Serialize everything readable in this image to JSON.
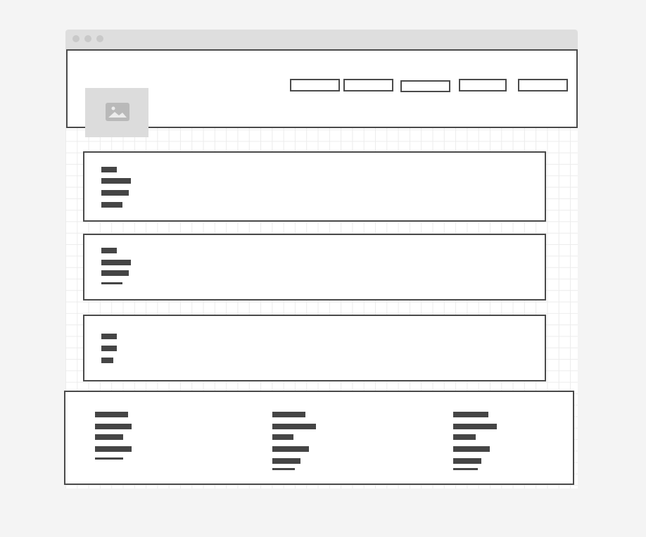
{
  "window": {
    "traffic_lights": [
      "close-dot",
      "minimize-dot",
      "maximize-dot"
    ]
  },
  "header": {
    "logo_icon": "image-placeholder-icon",
    "nav_buttons": [
      "",
      "",
      "",
      "",
      ""
    ]
  },
  "content_cards": [
    {
      "lines": [
        "",
        "",
        "",
        ""
      ]
    },
    {
      "lines": [
        "",
        "",
        "",
        ""
      ]
    },
    {
      "lines": [
        "",
        "",
        ""
      ]
    }
  ],
  "footer": {
    "columns": [
      {
        "lines": [
          "",
          "",
          "",
          "",
          ""
        ]
      },
      {
        "lines": [
          "",
          "",
          "",
          "",
          "",
          ""
        ]
      },
      {
        "lines": [
          "",
          "",
          "",
          "",
          "",
          ""
        ]
      }
    ]
  },
  "colors": {
    "page_background": "#f4f4f4",
    "titlebar": "#dedede",
    "outline": "#4a4a4a",
    "text_placeholder": "#454545",
    "image_placeholder": "#dcdcdc",
    "grid_line": "#ececec"
  }
}
